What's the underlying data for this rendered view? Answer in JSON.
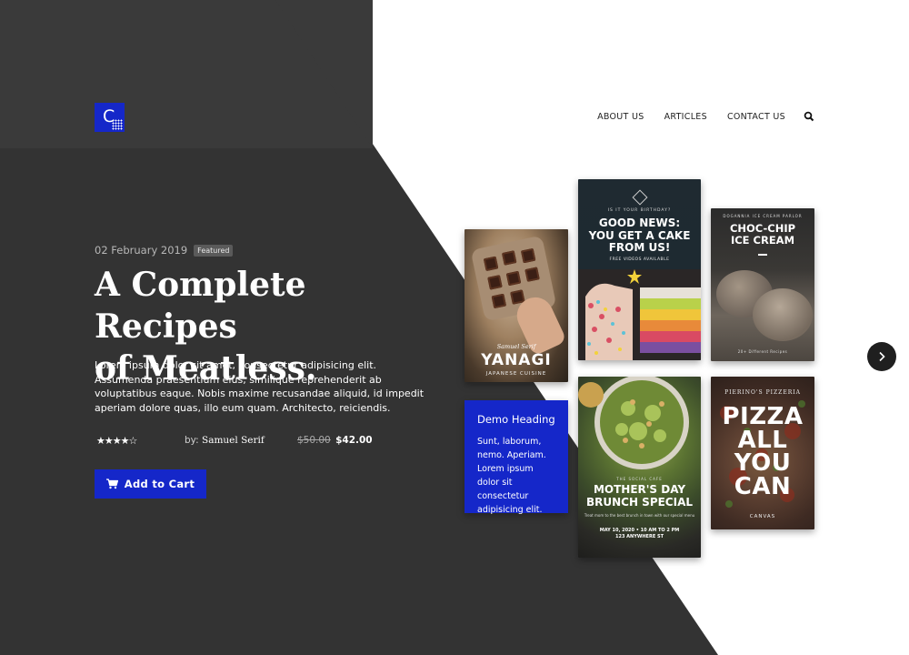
{
  "brand": {
    "logo_letter": "C",
    "accent": "#1527c9",
    "dark_bg": "#333333"
  },
  "nav": {
    "items": [
      {
        "label": "ABOUT US"
      },
      {
        "label": "ARTICLES"
      },
      {
        "label": "CONTACT US"
      }
    ],
    "search_icon": "search-icon"
  },
  "hero": {
    "date": "02 February 2019",
    "badge": "Featured",
    "title_line1": "A Complete Recipes",
    "title_line2": "of Meatless.",
    "description": "Lorem ipsum dolor sit amet, consectetur adipisicing elit. Assumenda praesentium eius, similique reprehenderit ab voluptatibus eaque. Nobis maxime recusandae aliquid, id impedit aperiam dolore quas, illo eum quam. Architecto, reiciendis.",
    "rating": 4.5,
    "rating_max": 5,
    "stars_text": "★★★★☆",
    "author_prefix": "by:",
    "author": "Samuel Serif",
    "price_old": "$50.00",
    "price_new": "$42.00",
    "cart_label": "Add to Cart",
    "cart_icon": "cart-icon"
  },
  "books": {
    "yanagi": {
      "author": "Samuel Serif",
      "title": "YANAGI",
      "subtitle": "JAPANESE CUISINE"
    },
    "good_news": {
      "top": "IS IT YOUR BIRTHDAY?",
      "line1": "GOOD NEWS:",
      "line2": "YOU GET A CAKE",
      "line3": "FROM US!",
      "sub": "FREE VIDEOS AVAILABLE"
    },
    "choc_chip": {
      "top": "DOGANNIA ICE CREAM PARLOR",
      "line1": "CHOC-CHIP",
      "line2": "ICE CREAM",
      "sub": "20+ Different Recipes"
    },
    "mothers_day": {
      "top": "THE SOCIAL CAFE",
      "line1": "MOTHER'S DAY",
      "line2": "BRUNCH SPECIAL",
      "small": "Treat mom to the best brunch in town with our special menu",
      "date_line": "MAY 10, 2020 • 10 AM TO 2 PM",
      "address": "123 ANYWHERE ST"
    },
    "pizza": {
      "top": "PIERINO'S PIZZERIA",
      "line1": "PIZZA",
      "line2": "ALL",
      "line3": "YOU",
      "line4": "CAN",
      "sub": "CANVAS"
    }
  },
  "demo_card": {
    "heading": "Demo Heading",
    "body": "Sunt, laborum, nemo. Aperiam. Lorem ipsum dolor sit consectetur adipisicing elit."
  },
  "carousel": {
    "next_icon": "chevron-right-icon"
  }
}
